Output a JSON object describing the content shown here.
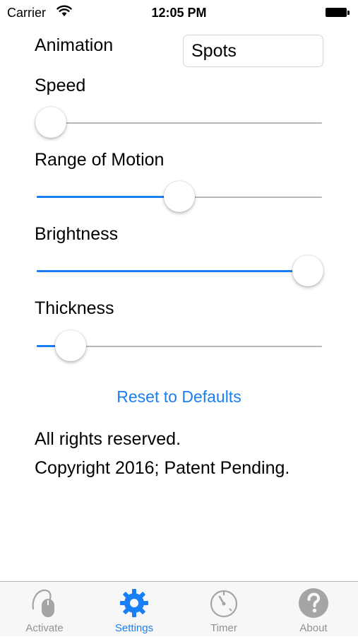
{
  "status_bar": {
    "carrier": "Carrier",
    "time": "12:05 PM"
  },
  "settings": {
    "animation_label": "Animation",
    "animation_value": "Spots",
    "sliders": [
      {
        "label": "Speed",
        "value": 0.05
      },
      {
        "label": "Range of Motion",
        "value": 0.5
      },
      {
        "label": "Brightness",
        "value": 0.95
      },
      {
        "label": "Thickness",
        "value": 0.12
      }
    ],
    "reset_label": "Reset to Defaults"
  },
  "footer": {
    "line1": "All rights reserved.",
    "line2": "Copyright 2016; Patent Pending."
  },
  "tab_bar": {
    "tabs": [
      {
        "label": "Activate",
        "icon": "mouse-hand-icon",
        "active": false
      },
      {
        "label": "Settings",
        "icon": "gear-icon",
        "active": true
      },
      {
        "label": "Timer",
        "icon": "timer-icon",
        "active": false
      },
      {
        "label": "About",
        "icon": "question-icon",
        "active": false
      }
    ]
  },
  "colors": {
    "accent": "#1a7ff5",
    "inactive": "#929292",
    "track": "#b7b7b7"
  }
}
